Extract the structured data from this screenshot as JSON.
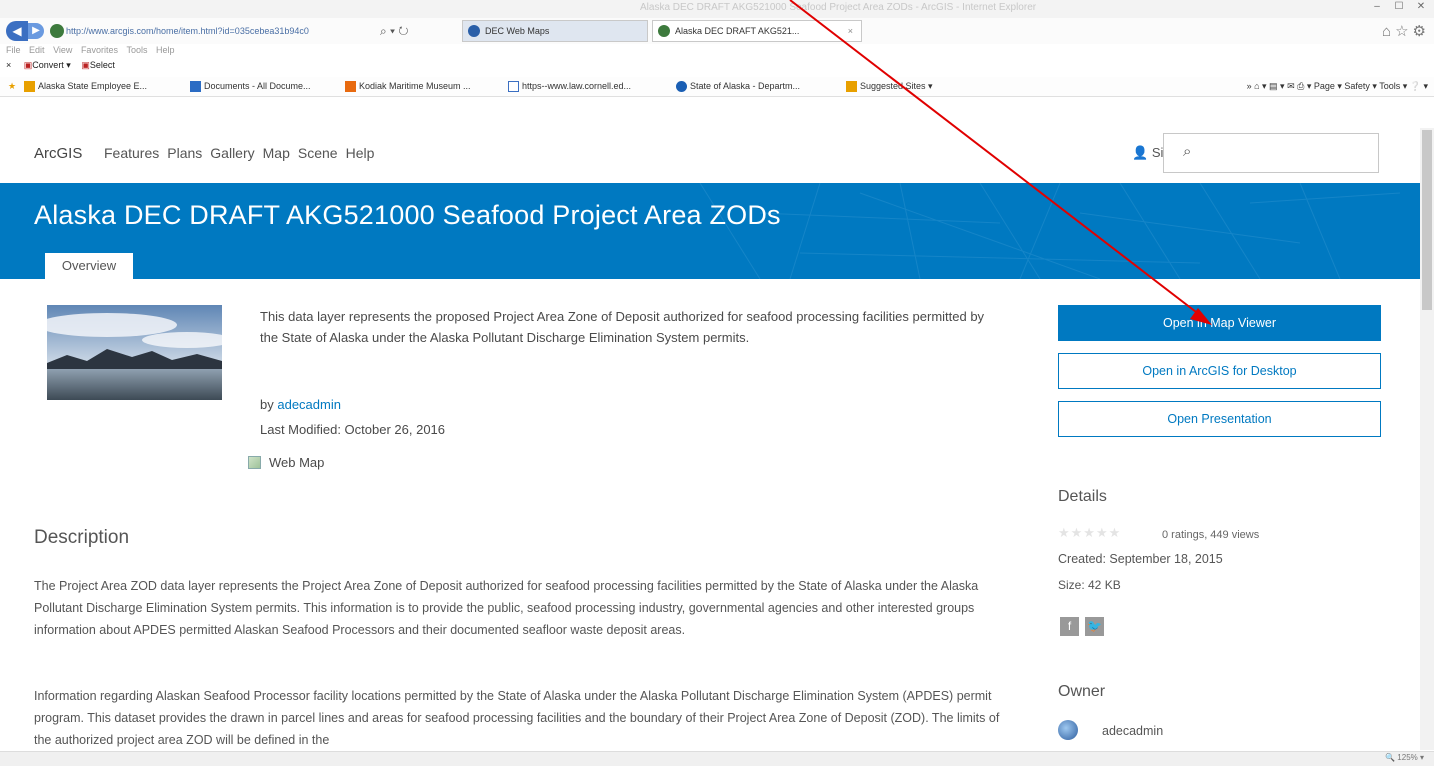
{
  "browser": {
    "window_title": "Alaska DEC DRAFT AKG521000 Seafood Project Area ZODs - ArcGIS - Internet Explorer",
    "url": "http://www.arcgis.com/home/item.html?id=035cebea31b94c0",
    "url_controls": "⌕ ▾ ↻",
    "tabs": [
      {
        "label": "DEC Web Maps"
      },
      {
        "label": "Alaska DEC DRAFT AKG521..."
      }
    ],
    "tab_close": "×",
    "menu": [
      "File",
      "Edit",
      "View",
      "Favorites",
      "Tools",
      "Help"
    ],
    "convert_bar": {
      "close": "×",
      "convert": "Convert ▾",
      "select": "Select"
    },
    "favorites": [
      "Alaska State Employee E...",
      "Documents - All Docume...",
      "Kodiak Maritime Museum ...",
      "https--www.law.cornell.ed...",
      "State of Alaska - Departm...",
      "Suggested Sites ▾"
    ],
    "command_bar": "» ⌂ ▾ ▤ ▾ ✉ ⎙ ▾ Page ▾ Safety ▾ Tools ▾ ❔ ▾",
    "right_icons": "⌂☆⚙",
    "zoom": "🔍 125% ▾"
  },
  "header": {
    "logo": "ArcGIS",
    "nav": [
      "Features",
      "Plans",
      "Gallery",
      "Map",
      "Scene",
      "Help"
    ],
    "sign_in": "Sign In",
    "search_placeholder": ""
  },
  "item": {
    "title": "Alaska DEC DRAFT AKG521000 Seafood Project Area ZODs",
    "tab_overview": "Overview",
    "summary": "This data layer represents the proposed Project Area Zone of Deposit authorized for seafood processing facilities permitted by the State of Alaska under the Alaska Pollutant Discharge Elimination System permits.",
    "by_prefix": "by",
    "owner": "adecadmin",
    "last_modified": "Last Modified: October 26, 2016",
    "type": "Web Map",
    "description_heading": "Description",
    "description_paragraphs": [
      "The Project Area ZOD data layer represents the Project Area Zone of Deposit authorized for seafood processing facilities permitted by the State of Alaska under the Alaska Pollutant Discharge Elimination System permits. This information is to provide the public, seafood processing industry, governmental agencies and other interested groups information about APDES permitted Alaskan Seafood Processors and their documented seafloor waste deposit areas.",
      "Information regarding Alaskan Seafood Processor facility locations permitted by the State of Alaska under the Alaska Pollutant Discharge Elimination System (APDES) permit program. This dataset provides the drawn in parcel lines and areas for seafood processing facilities and the boundary of their Project Area Zone of Deposit (ZOD). The limits of the authorized project area ZOD will be defined in the"
    ]
  },
  "actions": {
    "open_map_viewer": "Open in Map Viewer",
    "open_desktop": "Open in ArcGIS for Desktop",
    "open_presentation": "Open Presentation"
  },
  "details": {
    "heading": "Details",
    "stars": "★★★★★",
    "ratings": "0 ratings, 449 views",
    "created": "Created: September 18, 2015",
    "size": "Size: 42 KB",
    "facebook_glyph": "f",
    "twitter_glyph": "🐦"
  },
  "owner": {
    "heading": "Owner",
    "name": "adecadmin"
  },
  "colors": {
    "brand_blue": "#0079c1",
    "annotation_arrow": "#e00000"
  },
  "icons": [
    "back-arrow-icon",
    "forward-arrow-icon",
    "search-icon",
    "refresh-icon",
    "home-icon",
    "star-icon",
    "gear-icon",
    "user-icon",
    "map-icon",
    "facebook-icon",
    "twitter-icon"
  ]
}
